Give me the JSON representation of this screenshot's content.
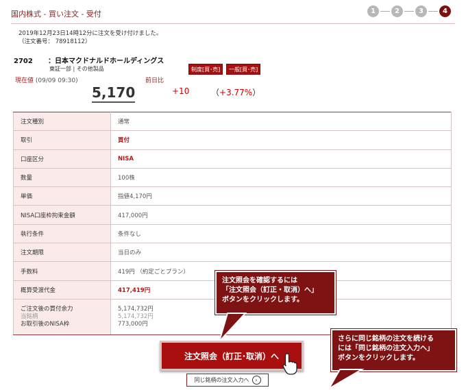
{
  "header": {
    "title": "国内株式 - 買い注文 - 受付",
    "steps": [
      "1",
      "2",
      "3",
      "4"
    ],
    "active_step": 4
  },
  "notice": {
    "line1": "2019年12月23日14時12分に注文を受け付けました。",
    "line2": "（注文番号： 78918112）"
  },
  "stock": {
    "code": "2702",
    "name": "：日本マクドナルドホールディングス",
    "sub": "東証一部 | その他製品",
    "tag1": "制度[買･売]",
    "tag2": "一般[買･売]"
  },
  "price": {
    "label": "現在値",
    "time": "(09/09 09:30)",
    "value": "5,170",
    "change_label": "前日比",
    "change": "+10",
    "pct_open": "（",
    "pct": "+3.77%",
    "pct_close": "）"
  },
  "rows": [
    {
      "label": "注文種別",
      "value": "通常"
    },
    {
      "label": "取引",
      "value": "買付"
    },
    {
      "label": "口座区分",
      "value": "NISA"
    },
    {
      "label": "数量",
      "value": "100株"
    },
    {
      "label": "単価",
      "value": "指値4,170円"
    },
    {
      "label": "NISA口座枠拘束金額",
      "value": "417,000円"
    },
    {
      "label": "執行条件",
      "value": "条件なし"
    },
    {
      "label": "注文期限",
      "value": "当日のみ"
    },
    {
      "label": "手数料",
      "value": "419円 （約定ごとプラン）"
    },
    {
      "label": "概算受渡代金",
      "value": "417,419円"
    }
  ],
  "balance": {
    "label1": "ご注文後の買付余力",
    "label2": "当銘柄",
    "label3": "お取引後のNISA枠",
    "value1": "5,174,732円",
    "value2": "5,174,732円",
    "value3": "773,000円"
  },
  "buttons": {
    "main": "注文照会（訂正･取消）へ",
    "sub": "同じ銘柄の注文入力へ",
    "sub_icon": "›"
  },
  "callouts": {
    "c1_line1": "注文照会を確認するには",
    "c1_line2": "「注文照会（訂正・取消）へ」",
    "c1_line3": "ボタンをクリックします。",
    "c2_line1": "さらに同じ銘柄の注文を続ける",
    "c2_line2": "には「同じ銘柄の注文入力へ」",
    "c2_line3": "ボタンをクリックします。"
  },
  "colors": {
    "accent": "#a90f0f",
    "callout": "#7f1212",
    "label_bg": "#fbeaea"
  }
}
